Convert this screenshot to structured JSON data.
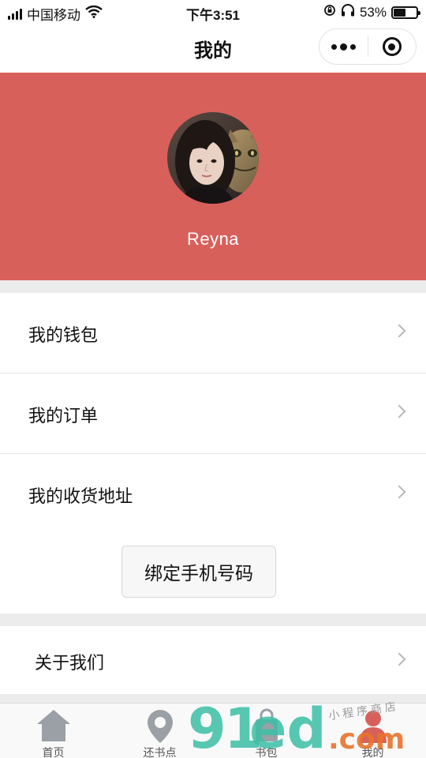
{
  "status_bar": {
    "carrier": "中国移动",
    "time": "下午3:51",
    "battery_text": "53%",
    "battery_level": 0.53,
    "icons": [
      "signal-icon",
      "wifi-icon",
      "rotation-lock-icon",
      "headphones-icon",
      "battery-icon"
    ]
  },
  "nav": {
    "title": "我的",
    "more_icon": "more-dots-icon",
    "close_icon": "target-icon"
  },
  "profile": {
    "username": "Reyna",
    "background_color": "#d8605b"
  },
  "menu": [
    {
      "label": "我的钱包"
    },
    {
      "label": "我的订单"
    },
    {
      "label": "我的收货地址"
    }
  ],
  "bind_button": {
    "label": "绑定手机号码"
  },
  "about": {
    "label": "关于我们"
  },
  "tabs": [
    {
      "label": "首页",
      "icon": "home-icon"
    },
    {
      "label": "还书点",
      "icon": "location-pin-icon"
    },
    {
      "label": "书包",
      "icon": "bag-icon"
    },
    {
      "label": "我的",
      "icon": "person-icon",
      "active": true
    }
  ],
  "watermark": {
    "brand_9": "9",
    "brand_1": "1",
    "brand_ed": "ed",
    "brand_com": ".com",
    "brand_small": "小程序商店"
  }
}
